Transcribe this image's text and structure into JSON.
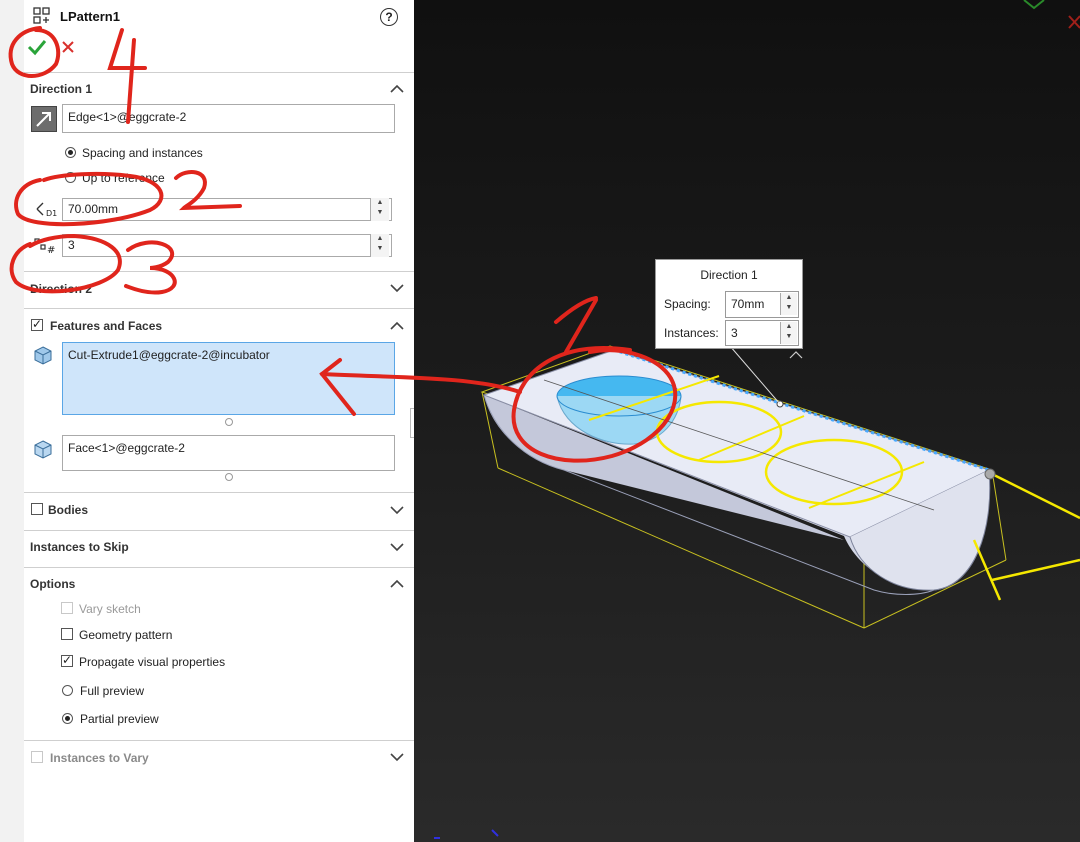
{
  "header": {
    "title": "LPattern1",
    "help": "?"
  },
  "direction1": {
    "heading": "Direction 1",
    "edge": "Edge<1>@eggcrate-2",
    "option_spacing": "Spacing and instances",
    "option_reference": "Up to reference",
    "spacing": "70.00mm",
    "instances": "3"
  },
  "direction2": {
    "heading": "Direction 2"
  },
  "features": {
    "heading": "Features and Faces",
    "feature": "Cut-Extrude1@eggcrate-2@incubator",
    "face": "Face<1>@eggcrate-2"
  },
  "bodies": {
    "heading": "Bodies"
  },
  "skip": {
    "heading": "Instances to Skip"
  },
  "options": {
    "heading": "Options",
    "vary_sketch": "Vary sketch",
    "geometry_pattern": "Geometry pattern",
    "propagate": "Propagate visual properties",
    "full_preview": "Full preview",
    "partial_preview": "Partial preview"
  },
  "vary": {
    "heading": "Instances to Vary"
  },
  "callout": {
    "title": "Direction 1",
    "spacing_label": "Spacing:",
    "spacing_value": "70mm",
    "instances_label": "Instances:",
    "instances_value": "3"
  },
  "annotations": {
    "n1": "1",
    "n2": "2",
    "n3": "3",
    "n4": "4"
  },
  "colors": {
    "accent_select": "#cfe5fa",
    "ok": "#2aa43a",
    "cancel": "#d9302c",
    "ink": "#e0251c",
    "sketch": "#f5e800"
  }
}
